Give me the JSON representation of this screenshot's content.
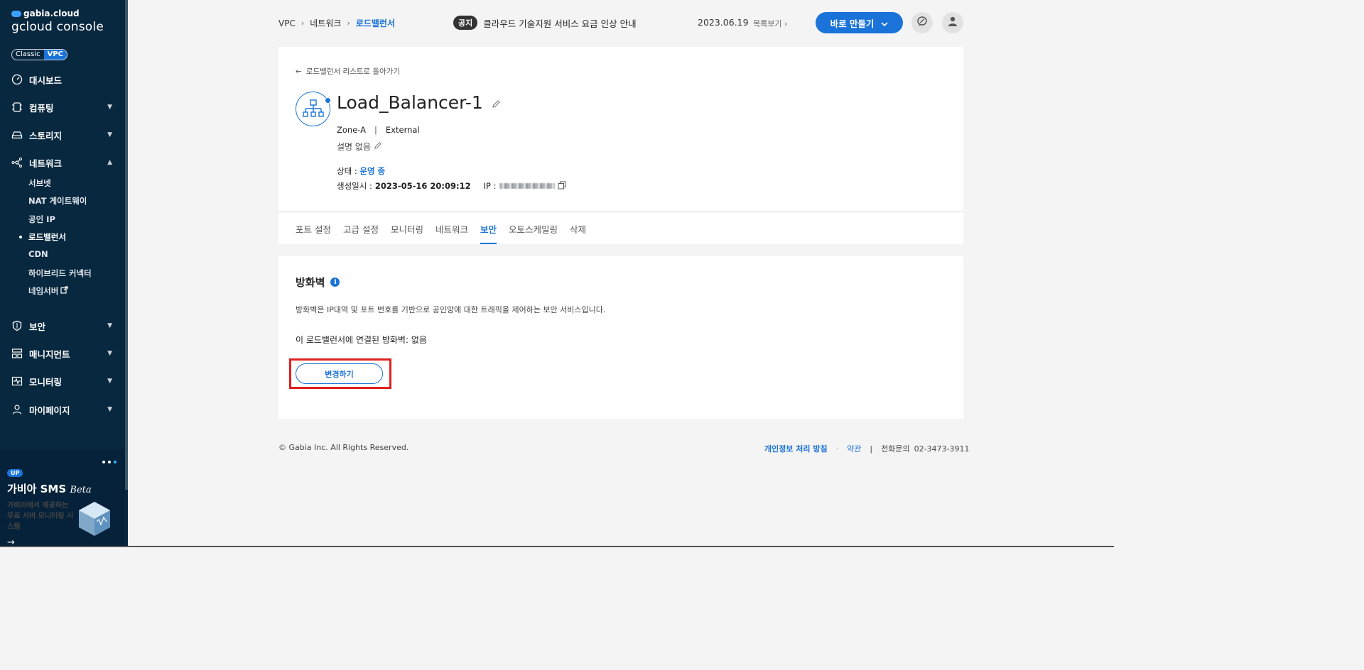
{
  "brand": {
    "top": "gabia.cloud",
    "main": "gcloud console"
  },
  "mode": {
    "classic": "Classic",
    "vpc": "VPC"
  },
  "sidebar": {
    "items": [
      {
        "label": "대시보드"
      },
      {
        "label": "컴퓨팅"
      },
      {
        "label": "스토리지"
      },
      {
        "label": "네트워크"
      },
      {
        "label": "보안"
      },
      {
        "label": "매니지먼트"
      },
      {
        "label": "모니터링"
      },
      {
        "label": "마이페이지"
      }
    ],
    "network_sub": [
      "서브넷",
      "NAT 게이트웨이",
      "공인 IP",
      "로드밸런서",
      "CDN",
      "하이브리드 커넥터",
      "네임서버"
    ]
  },
  "promo": {
    "badge": "UP",
    "title": "가비아 SMS",
    "title_em": "Beta",
    "desc": "가비아에서 제공하는 무료 서버 모니터링 시스템",
    "arrow": "→"
  },
  "breadcrumb": {
    "root": "VPC",
    "mid": "네트워크",
    "current": "로드밸런서"
  },
  "notice": {
    "tag": "공지",
    "text": "클라우드 기술지원 서비스 요금 인상 안내",
    "date": "2023.06.19",
    "list": "목록보기"
  },
  "header": {
    "create_label": "바로 만들기"
  },
  "lb": {
    "back": "로드밸런서 리스트로 돌아가기",
    "name": "Load_Balancer-1",
    "zone": "Zone-A",
    "type": "External",
    "desc": "설명 없음",
    "status_label": "상태 :",
    "status_value": "운영 중",
    "created_label": "생성일시 :",
    "created_value": "2023-05-16 20:09:12",
    "ip_label": "IP :"
  },
  "tabs": [
    "포트 설정",
    "고급 설정",
    "모니터링",
    "네트워크",
    "보안",
    "오토스케일링",
    "삭제"
  ],
  "firewall": {
    "title": "방화벽",
    "desc": "방화벽은 IP대역 및 포트 번호를 기반으로 공인망에 대한 트래픽을 제어하는 보안 서비스입니다.",
    "linked": "이 로드밸런서에 연결된 방화벽: 없음",
    "change_label": "변경하기"
  },
  "footer": {
    "copyright": "© Gabia Inc. All Rights Reserved.",
    "policy": "개인정보 처리 방침",
    "terms": "약관",
    "phone_label": "전화문의",
    "phone": "02-3473-3911"
  },
  "colors": {
    "accent": "#1a73d9",
    "sidebar": "#08283f",
    "highlight": "#e0201e"
  }
}
